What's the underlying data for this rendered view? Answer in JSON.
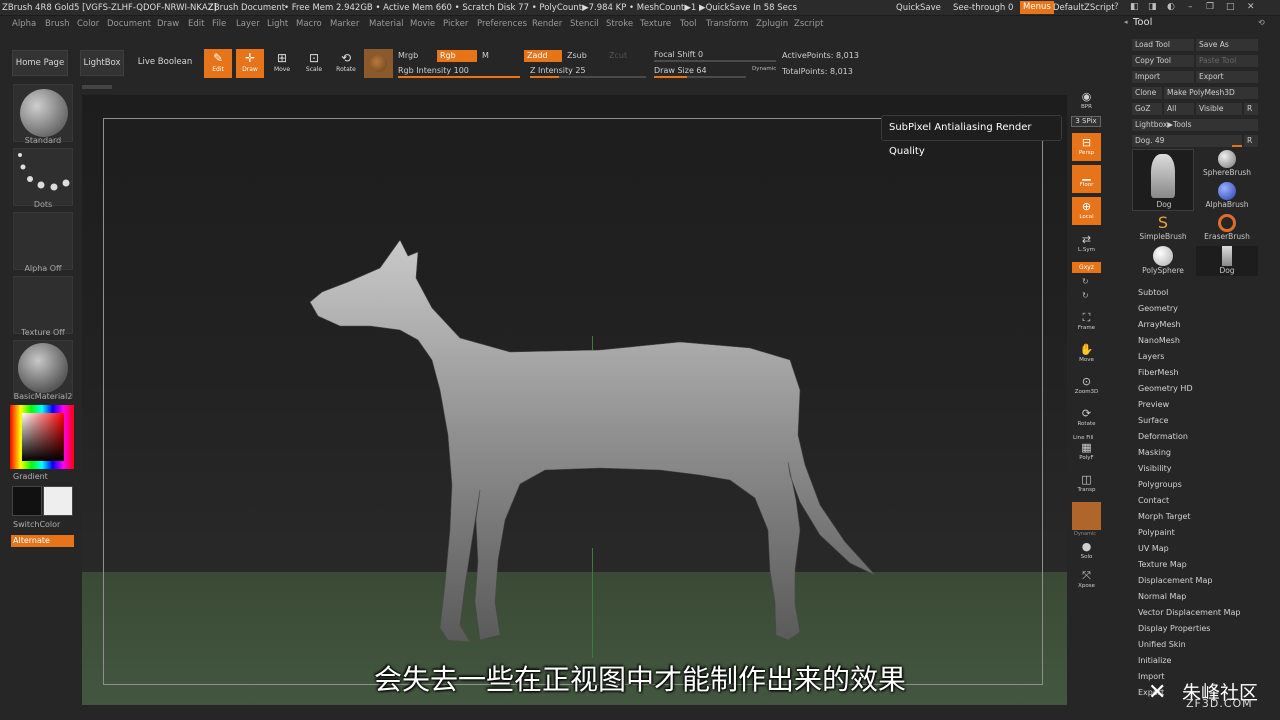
{
  "titlebar": {
    "app": "ZBrush 4R8 Gold5 [VGFS-ZLHF-QDOF-NRWI-NKAZ]",
    "doc": "ZBrush Document",
    "freemem": "• Free Mem 2.942GB • Active Mem 660 • Scratch Disk 77 • PolyCount▶7.984 KP • MeshCount▶1 ▶QuickSave In 58 Secs",
    "quicksave": "QuickSave",
    "seethrough": "See-through   0",
    "menus": "Menus",
    "script": "DefaultZScript"
  },
  "menubar": [
    "Alpha",
    "Brush",
    "Color",
    "Document",
    "Draw",
    "Edit",
    "File",
    "Layer",
    "Light",
    "Macro",
    "Marker",
    "Material",
    "Movie",
    "Picker",
    "Preferences",
    "Render",
    "Stencil",
    "Stroke",
    "Texture",
    "Tool",
    "Transform",
    "Zplugin",
    "Zscript"
  ],
  "shelf": {
    "home": "Home Page",
    "lightbox": "LightBox",
    "liveboolean": "Live Boolean",
    "edit": "Edit",
    "draw": "Draw",
    "move": "Move",
    "scale": "Scale",
    "rotate": "Rotate",
    "mrgb": "Mrgb",
    "rgb": "Rgb",
    "m": "M",
    "rgb_intensity": "Rgb Intensity 100",
    "zadd": "Zadd",
    "zsub": "Zsub",
    "zcut": "Zcut",
    "z_intensity": "Z Intensity 25",
    "focal_shift": "Focal Shift 0",
    "draw_size": "Draw Size 64",
    "dynamic": "Dynamic",
    "active_points": "ActivePoints: 8,013",
    "total_points": "TotalPoints: 8,013"
  },
  "left": {
    "brush": "Standard",
    "stroke": "Dots",
    "alpha": "Alpha Off",
    "texture": "Texture Off",
    "material": "BasicMaterial2",
    "gradient": "Gradient",
    "switchcolor": "SwitchColor",
    "alternate": "Alternate"
  },
  "right_shelf": {
    "bpr": "BPR",
    "spix": "3 SPix",
    "persp": "Persp",
    "floor": "Floor",
    "local": "Local",
    "lsym": "L.Sym",
    "xyz": "Gxyz",
    "frame": "Frame",
    "move": "Move",
    "zoom3d": "Zoom3D",
    "rotate": "Rotate",
    "linefill": "Line Fill",
    "polyf": "PolyF",
    "transp": "Transp",
    "ghost": "Dynamic",
    "solo": "Solo",
    "xpose": "Xpose"
  },
  "tooltip": "SubPixel Antialiasing Render Quality",
  "tool": {
    "title": "Tool",
    "load": "Load Tool",
    "saveas": "Save As",
    "copy": "Copy Tool",
    "paste": "Paste Tool",
    "import": "Import",
    "export": "Export",
    "clone": "Clone",
    "makepoly": "Make PolyMesh3D",
    "goz": "GoZ",
    "all": "All",
    "visible": "Visible",
    "r": "R",
    "lightbox_tools": "Lightbox▶Tools",
    "dog_slider": "Dog. 49",
    "cells": [
      "Dog",
      "SphereBrush",
      "AlphaBrush",
      "SimpleBrush",
      "EraserBrush",
      "PolySphere",
      "Dog"
    ],
    "subpalettes": [
      "Subtool",
      "Geometry",
      "ArrayMesh",
      "NanoMesh",
      "Layers",
      "FiberMesh",
      "Geometry HD",
      "Preview",
      "Surface",
      "Deformation",
      "Masking",
      "Visibility",
      "Polygroups",
      "Contact",
      "Morph Target",
      "Polypaint",
      "UV Map",
      "Texture Map",
      "Displacement Map",
      "Normal Map",
      "Vector Displacement Map",
      "Display Properties",
      "Unified Skin",
      "Initialize",
      "Import",
      "Export"
    ]
  },
  "subtitle": "会失去一些在正视图中才能制作出来的效果",
  "watermark": {
    "name": "朱峰社区",
    "site": "ZF3D.COM"
  },
  "colors": {
    "accent": "#e8741a",
    "panel": "#262626"
  }
}
